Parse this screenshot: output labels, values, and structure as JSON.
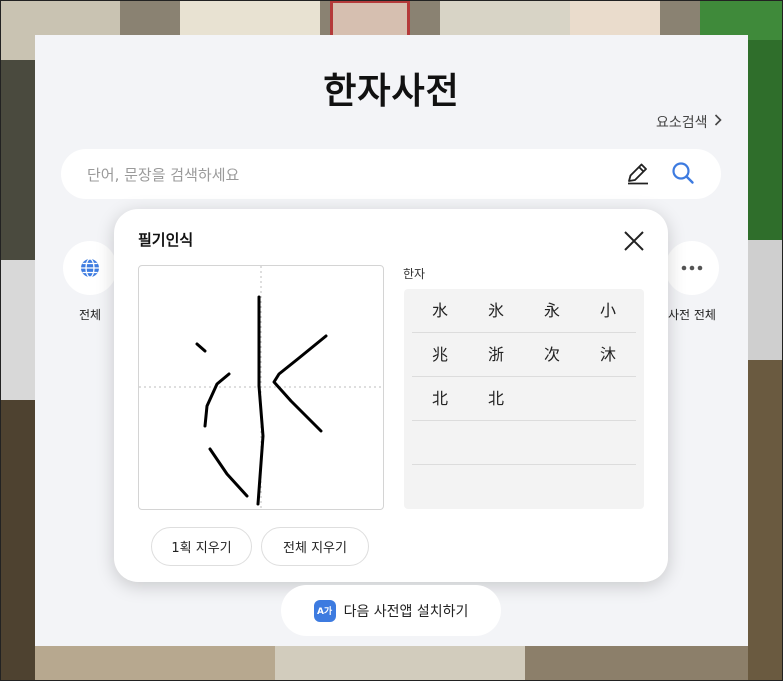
{
  "page": {
    "title": "한자사전",
    "element_search": "요소검색",
    "search": {
      "placeholder": "단어, 문장을 검색하세요",
      "value": ""
    }
  },
  "categories": {
    "all": "전체",
    "all_dictionaries": "사전 전체"
  },
  "handwriting": {
    "title": "필기인식",
    "candidates_label": "한자",
    "candidates": [
      [
        "水",
        "氷",
        "永",
        "小"
      ],
      [
        "兆",
        "浙",
        "次",
        "沐"
      ],
      [
        "北",
        "北",
        "",
        ""
      ],
      [
        "",
        "",
        "",
        ""
      ],
      [
        "",
        "",
        "",
        ""
      ]
    ],
    "undo_stroke": "1획 지우기",
    "clear_all": "전체 지우기"
  },
  "install": {
    "label": "다음 사전앱 설치하기",
    "icon_text": "A가"
  },
  "colors": {
    "accent": "#3d7be0",
    "panel": "#f3f4f7"
  }
}
